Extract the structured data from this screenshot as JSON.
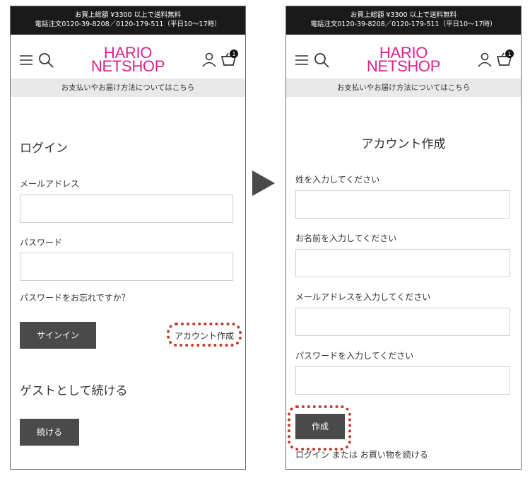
{
  "top_bar": {
    "line1": "お買上総額 ¥3300 以上で送料無料",
    "line2": "電話注文0120-39-8208／0120-179-511（平日10～17時）"
  },
  "logo": {
    "line1": "HARIO",
    "line2": "NETSHOP"
  },
  "cart": {
    "count": "1"
  },
  "info_bar": {
    "text": "お支払いやお届け方法についてはこちら"
  },
  "login_screen": {
    "title": "ログイン",
    "email_label": "メールアドレス",
    "password_label": "パスワード",
    "forgot_link": "パスワードをお忘れですか？",
    "signin_button": "サインイン",
    "create_account_link": "アカウント作成",
    "guest_title": "ゲストとして続ける",
    "continue_button": "続ける"
  },
  "create_account_screen": {
    "title": "アカウント作成",
    "last_name_label": "姓を入力してください",
    "first_name_label": "お名前を入力してください",
    "email_label": "メールアドレスを入力してください",
    "password_label": "パスワードを入力してください",
    "create_button": "作成",
    "footer_link_login": "ログイン",
    "footer_or": "または",
    "footer_link_continue": "お買い物を続ける"
  },
  "colors": {
    "brand_pink": "#e0218a",
    "dark_bar": "#1a1a1a",
    "button": "#4a4a4a",
    "highlight_dots": "#c0392b"
  },
  "icons": [
    "menu-icon",
    "search-icon",
    "user-icon",
    "cart-icon",
    "arrow-right-icon"
  ]
}
